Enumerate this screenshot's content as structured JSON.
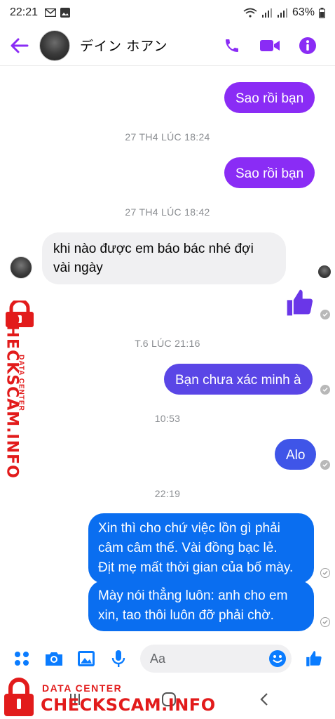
{
  "status_bar": {
    "time": "22:21",
    "battery": "63%"
  },
  "header": {
    "contact_name": "デイン ホアン"
  },
  "timestamps": {
    "t1": "27 TH4 LÚC 18:24",
    "t2": "27 TH4 LÚC 18:42",
    "t3": "T.6 LÚC 21:16",
    "t4": "10:53",
    "t5": "22:19"
  },
  "messages": {
    "m1": "Sao rồi bạn",
    "m2": "Sao rồi bạn",
    "m3_line1": "khi nào được em báo bác nhé đợi",
    "m3_line2": "vài ngày",
    "m5": "Bạn chưa xác minh à",
    "m6": "Alo",
    "m7_line1": "Xin thì cho chứ việc lồn gì phải",
    "m7_line2": "câm câm thế. Vài đồng bạc lẻ.",
    "m7_line3": "Địt mẹ mất thời gian của bố mày.",
    "m8_line1": "Mày nói thẳng luôn: anh cho em",
    "m8_line2": "xin, tao thôi luôn đỡ phải chờ."
  },
  "composer": {
    "placeholder": "Aa"
  },
  "watermark": {
    "sub": "DATA CENTER",
    "main": "CHECKSCAM.INFO"
  },
  "colors": {
    "accent": "#8a2cf5",
    "bubble_purple": "#8a2cf5",
    "bubble_indigo": "#5a46e6",
    "bubble_blue": "#0a6ef0",
    "composer_blue": "#0a7cff",
    "watermark_red": "#e21b1b"
  },
  "icons": [
    "back-arrow-icon",
    "phone-icon",
    "video-icon",
    "info-icon",
    "apps-icon",
    "camera-icon",
    "image-icon",
    "mic-icon",
    "emoji-icon",
    "thumbs-up-icon",
    "lock-icon"
  ]
}
